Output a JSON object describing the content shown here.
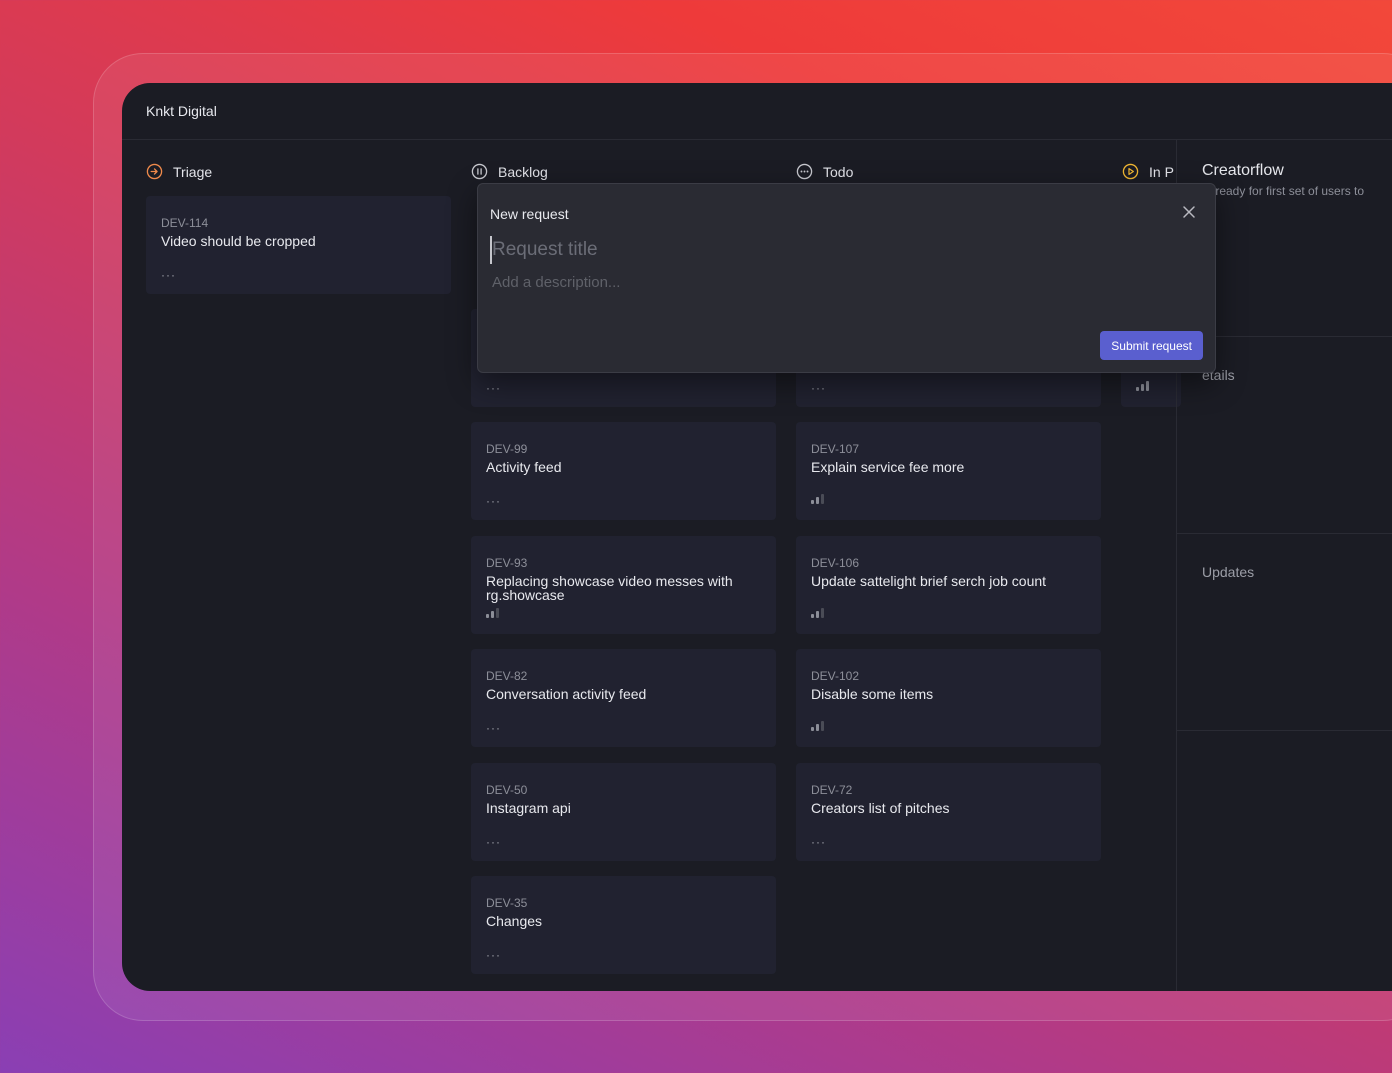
{
  "workspace": {
    "name": "Knkt Digital"
  },
  "columns": [
    {
      "label": "Triage",
      "icon": "triage-arrow-circle-icon",
      "color": "#f08a4b"
    },
    {
      "label": "Backlog",
      "icon": "pause-circle-icon",
      "color": "#c8c9cf"
    },
    {
      "label": "Todo",
      "icon": "dots-circle-icon",
      "color": "#c8c9cf"
    },
    {
      "label": "In P",
      "icon": "play-circle-icon",
      "color": "#f2b833"
    }
  ],
  "cards": {
    "triage": [
      {
        "id": "DEV-114",
        "title": "Video should be cropped"
      }
    ],
    "backlog": [
      {
        "id": "DEV-99",
        "title": "Activity feed"
      },
      {
        "id": "DEV-93",
        "title": "Replacing showcase video messes with rg.showcase"
      },
      {
        "id": "DEV-82",
        "title": "Conversation activity feed"
      },
      {
        "id": "DEV-50",
        "title": "Instagram api"
      },
      {
        "id": "DEV-35",
        "title": "Changes"
      }
    ],
    "todo": [
      {
        "id": "DEV-107",
        "title": "Explain service fee more"
      },
      {
        "id": "DEV-106",
        "title": "Update sattelight brief serch job count"
      },
      {
        "id": "DEV-102",
        "title": "Disable some items"
      },
      {
        "id": "DEV-72",
        "title": "Creators list of pitches"
      }
    ]
  },
  "right_panel": {
    "project_title": "Creatorflow",
    "project_subtitle": "ta ready for first set of users to",
    "details_label": "etails",
    "updates_label": "Updates"
  },
  "modal": {
    "title": "New request",
    "title_placeholder": "Request title",
    "description_placeholder": "Add a description...",
    "submit_label": "Submit request",
    "accent": "#5a5fcf"
  }
}
